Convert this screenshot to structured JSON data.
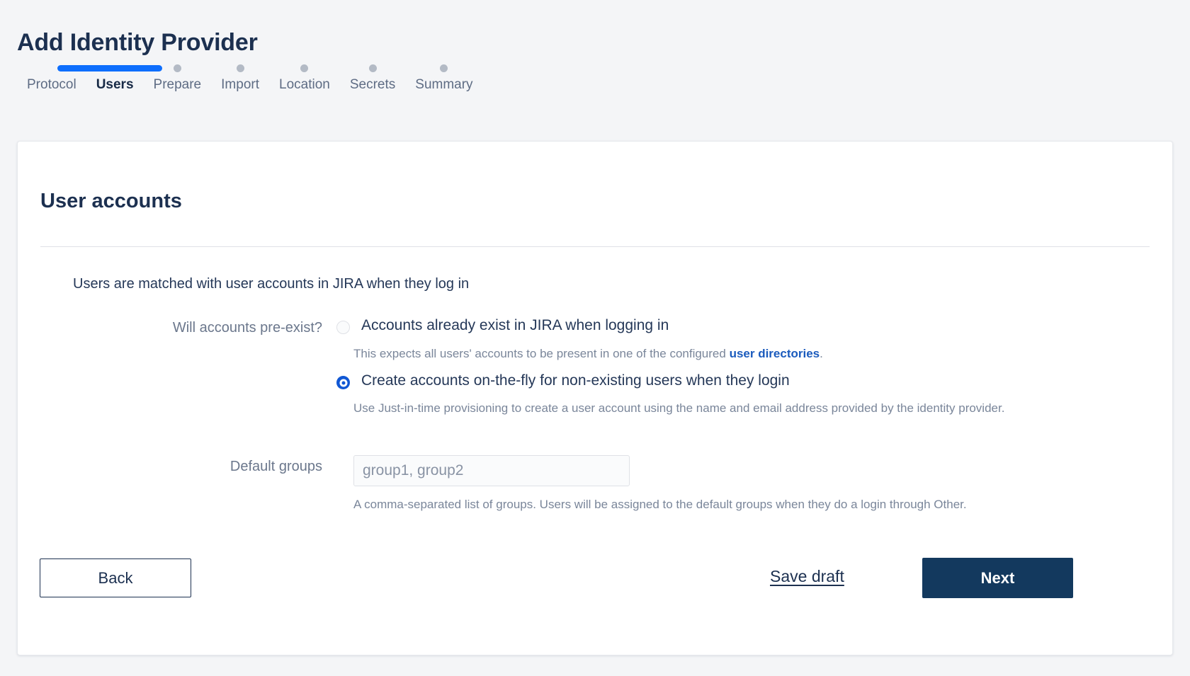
{
  "header": {
    "title": "Add Identity Provider"
  },
  "stepper": {
    "active_index": 1,
    "progress_color": "#0d6efd",
    "dot_color": "#b3bac5",
    "steps": [
      {
        "label": "Protocol",
        "state": "done"
      },
      {
        "label": "Users",
        "state": "current"
      },
      {
        "label": "Prepare",
        "state": "upcoming"
      },
      {
        "label": "Import",
        "state": "upcoming"
      },
      {
        "label": "Location",
        "state": "upcoming"
      },
      {
        "label": "Secrets",
        "state": "upcoming"
      },
      {
        "label": "Summary",
        "state": "upcoming"
      }
    ]
  },
  "card": {
    "section_title": "User accounts",
    "intro_text": "Users are matched with user accounts in JIRA when they log in",
    "preexist": {
      "label": "Will accounts pre-exist?",
      "options": [
        {
          "label": "Accounts already exist in JIRA when logging in",
          "selected": false,
          "helper_prefix": "This expects all users' accounts to be present in one of the configured ",
          "helper_link": "user directories",
          "helper_suffix": "."
        },
        {
          "label": "Create accounts on-the-fly for non-existing users when they login",
          "selected": true,
          "helper_prefix": "Use Just-in-time provisioning to create a user account using the name and email address provided by the identity provider.",
          "helper_link": "",
          "helper_suffix": ""
        }
      ]
    },
    "default_groups": {
      "label": "Default groups",
      "value": "",
      "placeholder": "group1, group2",
      "helper": "A comma-separated list of groups. Users will be assigned to the default groups when they do a login through Other."
    }
  },
  "footer": {
    "back_label": "Back",
    "save_draft_label": "Save draft",
    "next_label": "Next",
    "next_bg": "#13395e"
  }
}
